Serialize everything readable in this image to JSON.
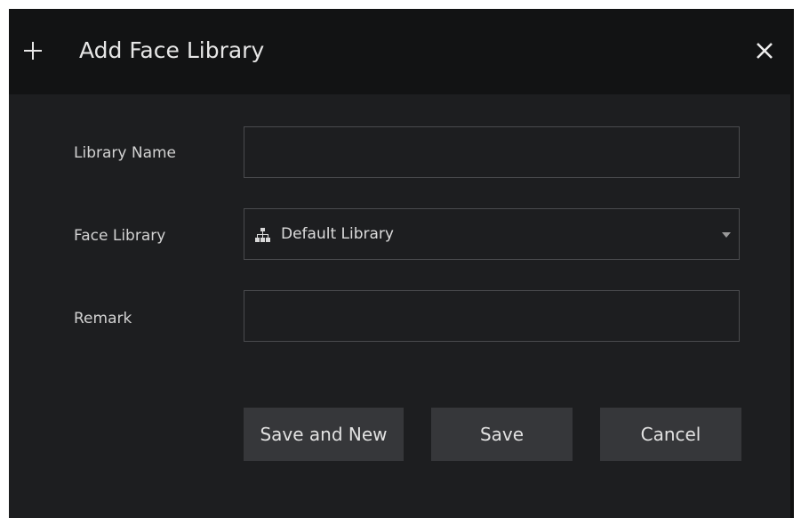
{
  "dialog": {
    "title": "Add Face Library",
    "icons": {
      "title": "plus-icon",
      "close": "close-icon"
    }
  },
  "form": {
    "library_name": {
      "label": "Library Name",
      "value": ""
    },
    "face_library": {
      "label": "Face Library",
      "selected": "Default Library",
      "icon": "tree-icon"
    },
    "remark": {
      "label": "Remark",
      "value": ""
    }
  },
  "buttons": {
    "save_and_new": "Save and New",
    "save": "Save",
    "cancel": "Cancel"
  }
}
